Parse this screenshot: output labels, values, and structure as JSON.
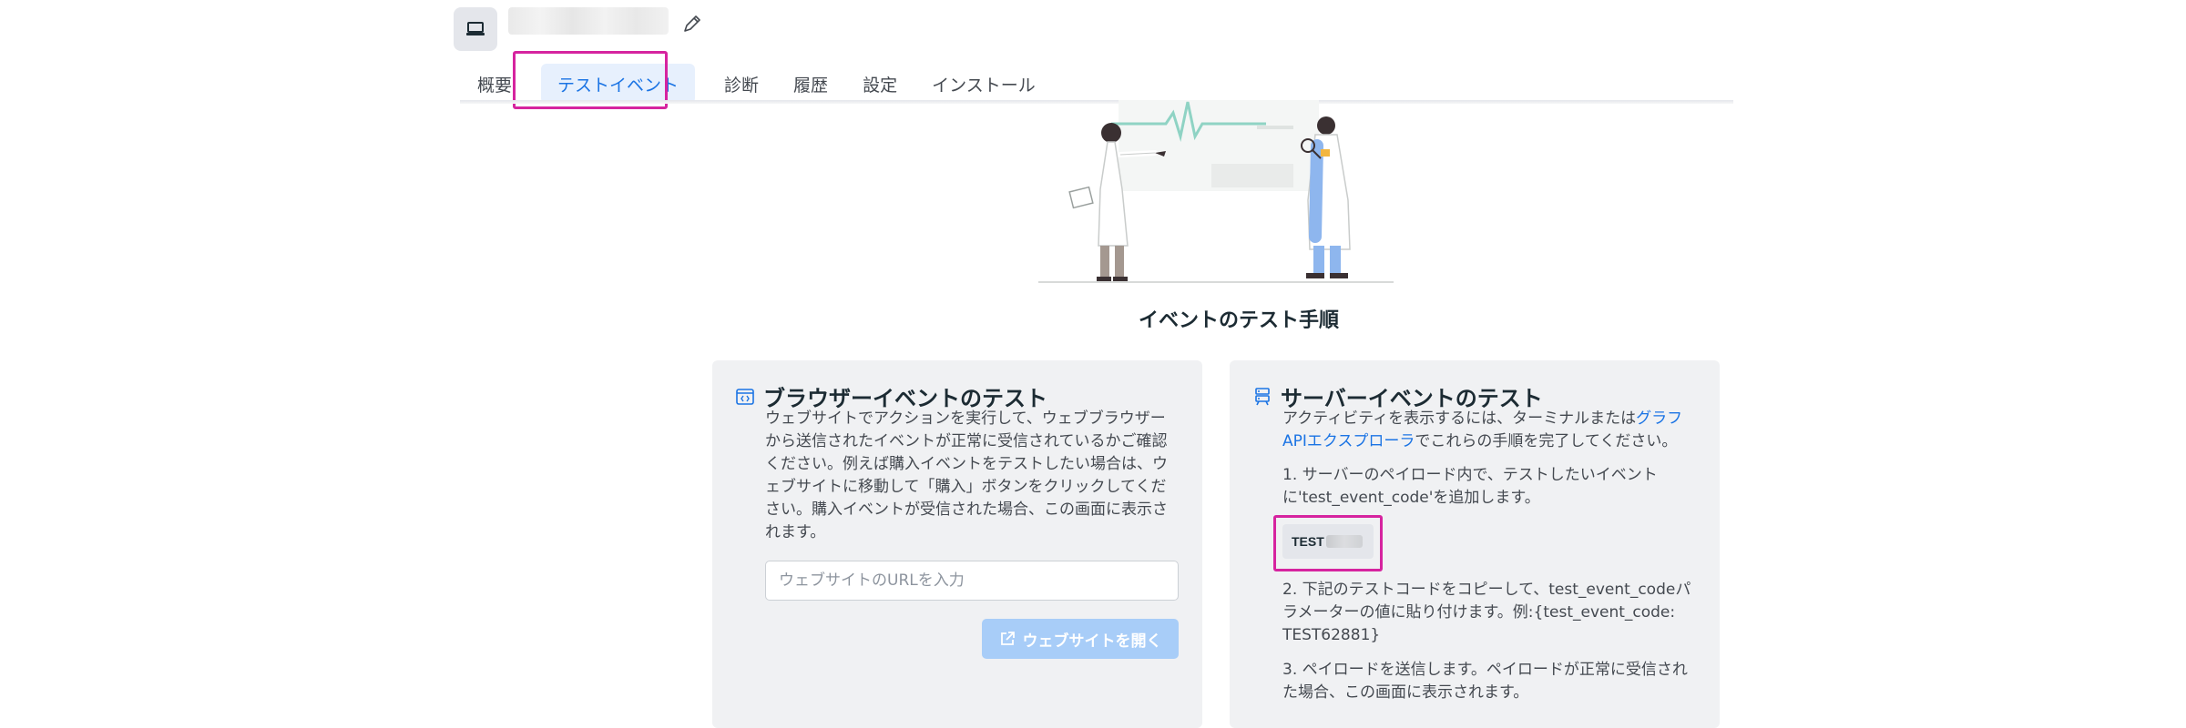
{
  "header": {
    "app_icon": "laptop-icon",
    "edit_icon": "pencil-icon"
  },
  "tabs": [
    {
      "label": "概要"
    },
    {
      "label": "テストイベント",
      "active": true
    },
    {
      "label": "診断"
    },
    {
      "label": "履歴"
    },
    {
      "label": "設定"
    },
    {
      "label": "インストール"
    }
  ],
  "main": {
    "steps_title": "イベントのテスト手順"
  },
  "browser_card": {
    "icon": "browser-code-icon",
    "title": "ブラウザーイベントのテスト",
    "description": "ウェブサイトでアクションを実行して、ウェブブラウザーから送信されたイベントが正常に受信されているかご確認ください。例えば購入イベントをテストしたい場合は、ウェブサイトに移動して「購入」ボタンをクリックしてください。購入イベントが受信された場合、この画面に表示されます。",
    "url_placeholder": "ウェブサイトのURLを入力",
    "open_button_label": "ウェブサイトを開く",
    "open_button_icon": "external-link-icon"
  },
  "server_card": {
    "icon": "server-icon",
    "title": "サーバーイベントのテスト",
    "description_before": "アクティビティを表示するには、ターミナルまたは",
    "description_link": "グラフAPIエクスプローラ",
    "description_after": "でこれらの手順を完了してください。",
    "step1": "1. サーバーのペイロード内で、テストしたいイベントに'test_event_code'を追加します。",
    "test_code_prefix": "TEST",
    "step2": "2. 下記のテストコードをコピーして、test_event_codeパラメーターの値に貼り付けます。例:{test_event_code: TEST62881}",
    "step3": "3. ペイロードを送信します。ペイロードが正常に受信された場合、この画面に表示されます。"
  },
  "colors": {
    "accent": "#1b74e4",
    "highlight": "#d6249f",
    "card_bg": "#f0f1f3",
    "button_disabled": "#a8cdf8"
  }
}
